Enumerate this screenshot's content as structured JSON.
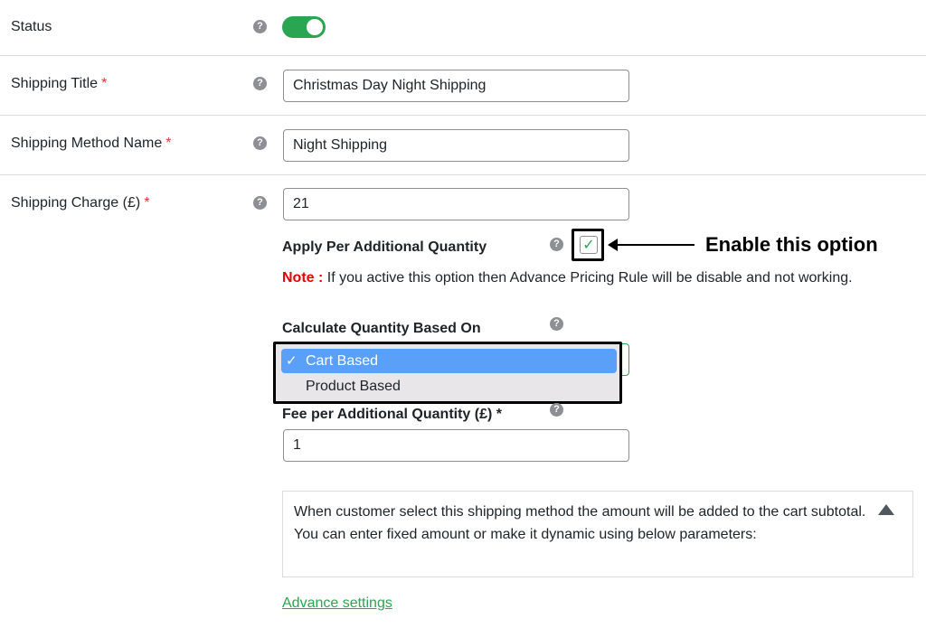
{
  "status": {
    "label": "Status",
    "enabled": true
  },
  "shipping_title": {
    "label": "Shipping Title",
    "required_mark": "*",
    "value": "Christmas Day Night Shipping"
  },
  "method_name": {
    "label": "Shipping Method Name",
    "required_mark": "*",
    "value": "Night Shipping"
  },
  "shipping_charge": {
    "label": "Shipping Charge (£)",
    "required_mark": "*",
    "value": "21"
  },
  "apply_per_quantity": {
    "label": "Apply Per Additional Quantity",
    "checked": true,
    "check_glyph": "✓"
  },
  "annotation": {
    "text": "Enable this option"
  },
  "note": {
    "prefix": "Note :",
    "text": " If you active this option then Advance Pricing Rule will be disable and not working."
  },
  "calc_quantity": {
    "label": "Calculate Quantity Based On",
    "options": [
      {
        "label": "Cart Based",
        "selected": true,
        "tick": "✓"
      },
      {
        "label": "Product Based",
        "selected": false
      }
    ]
  },
  "fee_per_quantity": {
    "label": "Fee per Additional Quantity (£) *",
    "value": "1"
  },
  "info_box": {
    "text": "When customer select this shipping method the amount will be added to the cart subtotal. You can enter fixed amount or make it dynamic using below parameters:"
  },
  "advance_settings": {
    "label": "Advance settings"
  },
  "help_glyph": "?",
  "colors": {
    "accent": "#2aa552",
    "required": "#d63638",
    "note": "#e50000",
    "selection": "#5ba0f8"
  }
}
